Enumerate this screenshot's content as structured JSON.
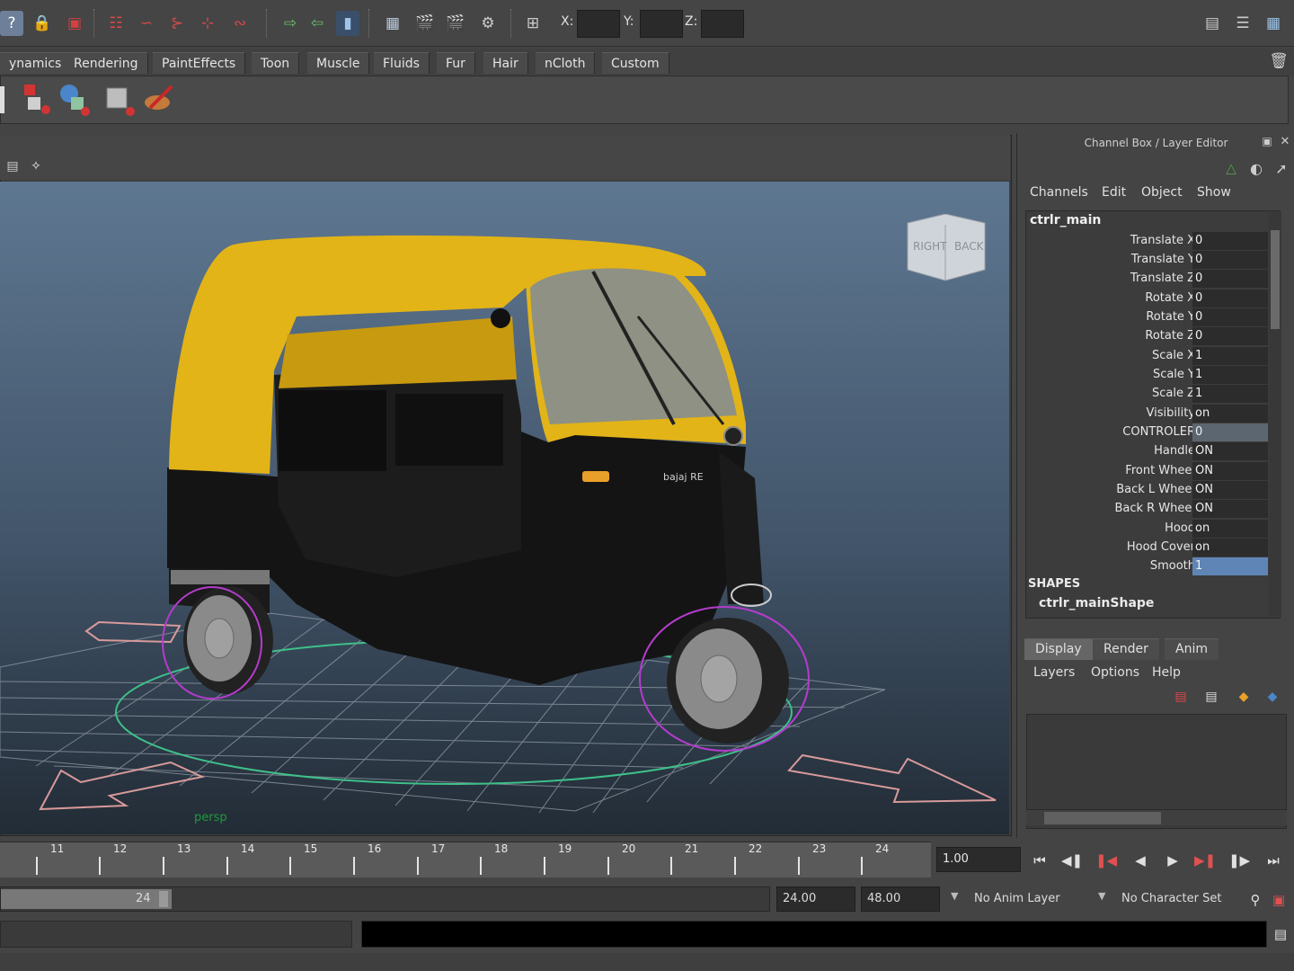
{
  "status_line": {
    "coord_x_label": "X:",
    "coord_y_label": "Y:",
    "coord_z_label": "Z:"
  },
  "shelf_tabs": [
    "ynamics",
    "Rendering",
    "PaintEffects",
    "Toon",
    "Muscle",
    "Fluids",
    "Fur",
    "Hair",
    "nCloth",
    "Custom"
  ],
  "viewport": {
    "camera_label": "persp",
    "viewcube_right": "RIGHT",
    "viewcube_back": "BACK",
    "model_badge": "bajaj RE"
  },
  "channel_box": {
    "title": "Channel Box / Layer Editor",
    "menus": [
      "Channels",
      "Edit",
      "Object",
      "Show"
    ],
    "node": "ctrlr_main",
    "channels": [
      {
        "name": "Translate X",
        "value": "0"
      },
      {
        "name": "Translate Y",
        "value": "0"
      },
      {
        "name": "Translate Z",
        "value": "0"
      },
      {
        "name": "Rotate X",
        "value": "0"
      },
      {
        "name": "Rotate Y",
        "value": "0"
      },
      {
        "name": "Rotate Z",
        "value": "0"
      },
      {
        "name": "Scale X",
        "value": "1"
      },
      {
        "name": "Scale Y",
        "value": "1"
      },
      {
        "name": "Scale Z",
        "value": "1"
      },
      {
        "name": "Visibility",
        "value": "on"
      },
      {
        "name": "CONTROLER",
        "value": "0"
      },
      {
        "name": "Handle",
        "value": "ON"
      },
      {
        "name": "Front Wheel",
        "value": "ON"
      },
      {
        "name": "Back L Wheel",
        "value": "ON"
      },
      {
        "name": "Back R Wheel",
        "value": "ON"
      },
      {
        "name": "Hood",
        "value": "on"
      },
      {
        "name": "Hood Cover",
        "value": "on"
      },
      {
        "name": "Smooth",
        "value": "1"
      }
    ],
    "shapes_header": "SHAPES",
    "shape_node": "ctrlr_mainShape"
  },
  "layer_editor": {
    "tabs": [
      "Display",
      "Render",
      "Anim"
    ],
    "active_tab": "Display",
    "menus": [
      "Layers",
      "Options",
      "Help"
    ]
  },
  "time_slider": {
    "frames": [
      "11",
      "12",
      "13",
      "14",
      "15",
      "16",
      "17",
      "18",
      "19",
      "20",
      "21",
      "22",
      "23",
      "24"
    ],
    "current_time": "1.00"
  },
  "range_slider": {
    "range_end_label": "24",
    "playback_end": "24.00",
    "anim_end": "48.00",
    "anim_layer": "No Anim Layer",
    "character_set": "No Character Set"
  },
  "colors": {
    "accent_selection": "#5f85b6",
    "body_yellow": "#e2b418",
    "body_black": "#141414",
    "nurbs_magenta": "#b43ccc",
    "nurbs_green": "#3fc08a",
    "arrow_pink": "#d89a9a"
  }
}
